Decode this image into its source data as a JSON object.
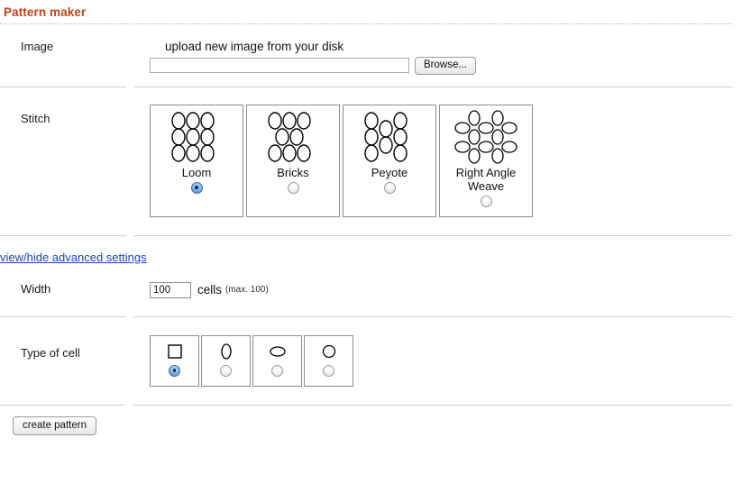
{
  "page": {
    "title": "Pattern maker"
  },
  "image": {
    "label": "Image",
    "caption": "upload new image from your disk",
    "file_value": "",
    "file_placeholder": "",
    "browse_label": "Browse..."
  },
  "stitch": {
    "label": "Stitch",
    "options": [
      {
        "name": "Loom",
        "icon": "loom-grid-icon",
        "selected": true
      },
      {
        "name": "Bricks",
        "icon": "bricks-grid-icon",
        "selected": false
      },
      {
        "name": "Peyote",
        "icon": "peyote-grid-icon",
        "selected": false
      },
      {
        "name": "Right Angle Weave",
        "icon": "right-angle-weave-icon",
        "selected": false
      }
    ]
  },
  "advanced": {
    "link_label": "view/hide advanced settings"
  },
  "width": {
    "label": "Width",
    "value": "100",
    "unit": "cells",
    "max_note": "(max. 100)"
  },
  "cell_type": {
    "label": "Type of cell",
    "options": [
      {
        "shape": "square-cell-icon",
        "selected": true
      },
      {
        "shape": "tall-ellipse-cell-icon",
        "selected": false
      },
      {
        "shape": "wide-ellipse-cell-icon",
        "selected": false
      },
      {
        "shape": "circle-cell-icon",
        "selected": false
      }
    ]
  },
  "footer": {
    "create_label": "create pattern"
  },
  "colors": {
    "title": "#C0441C",
    "link": "#1A3FCC",
    "radio_selected": "#4F8CCB",
    "separator": "#CFCFCF"
  }
}
